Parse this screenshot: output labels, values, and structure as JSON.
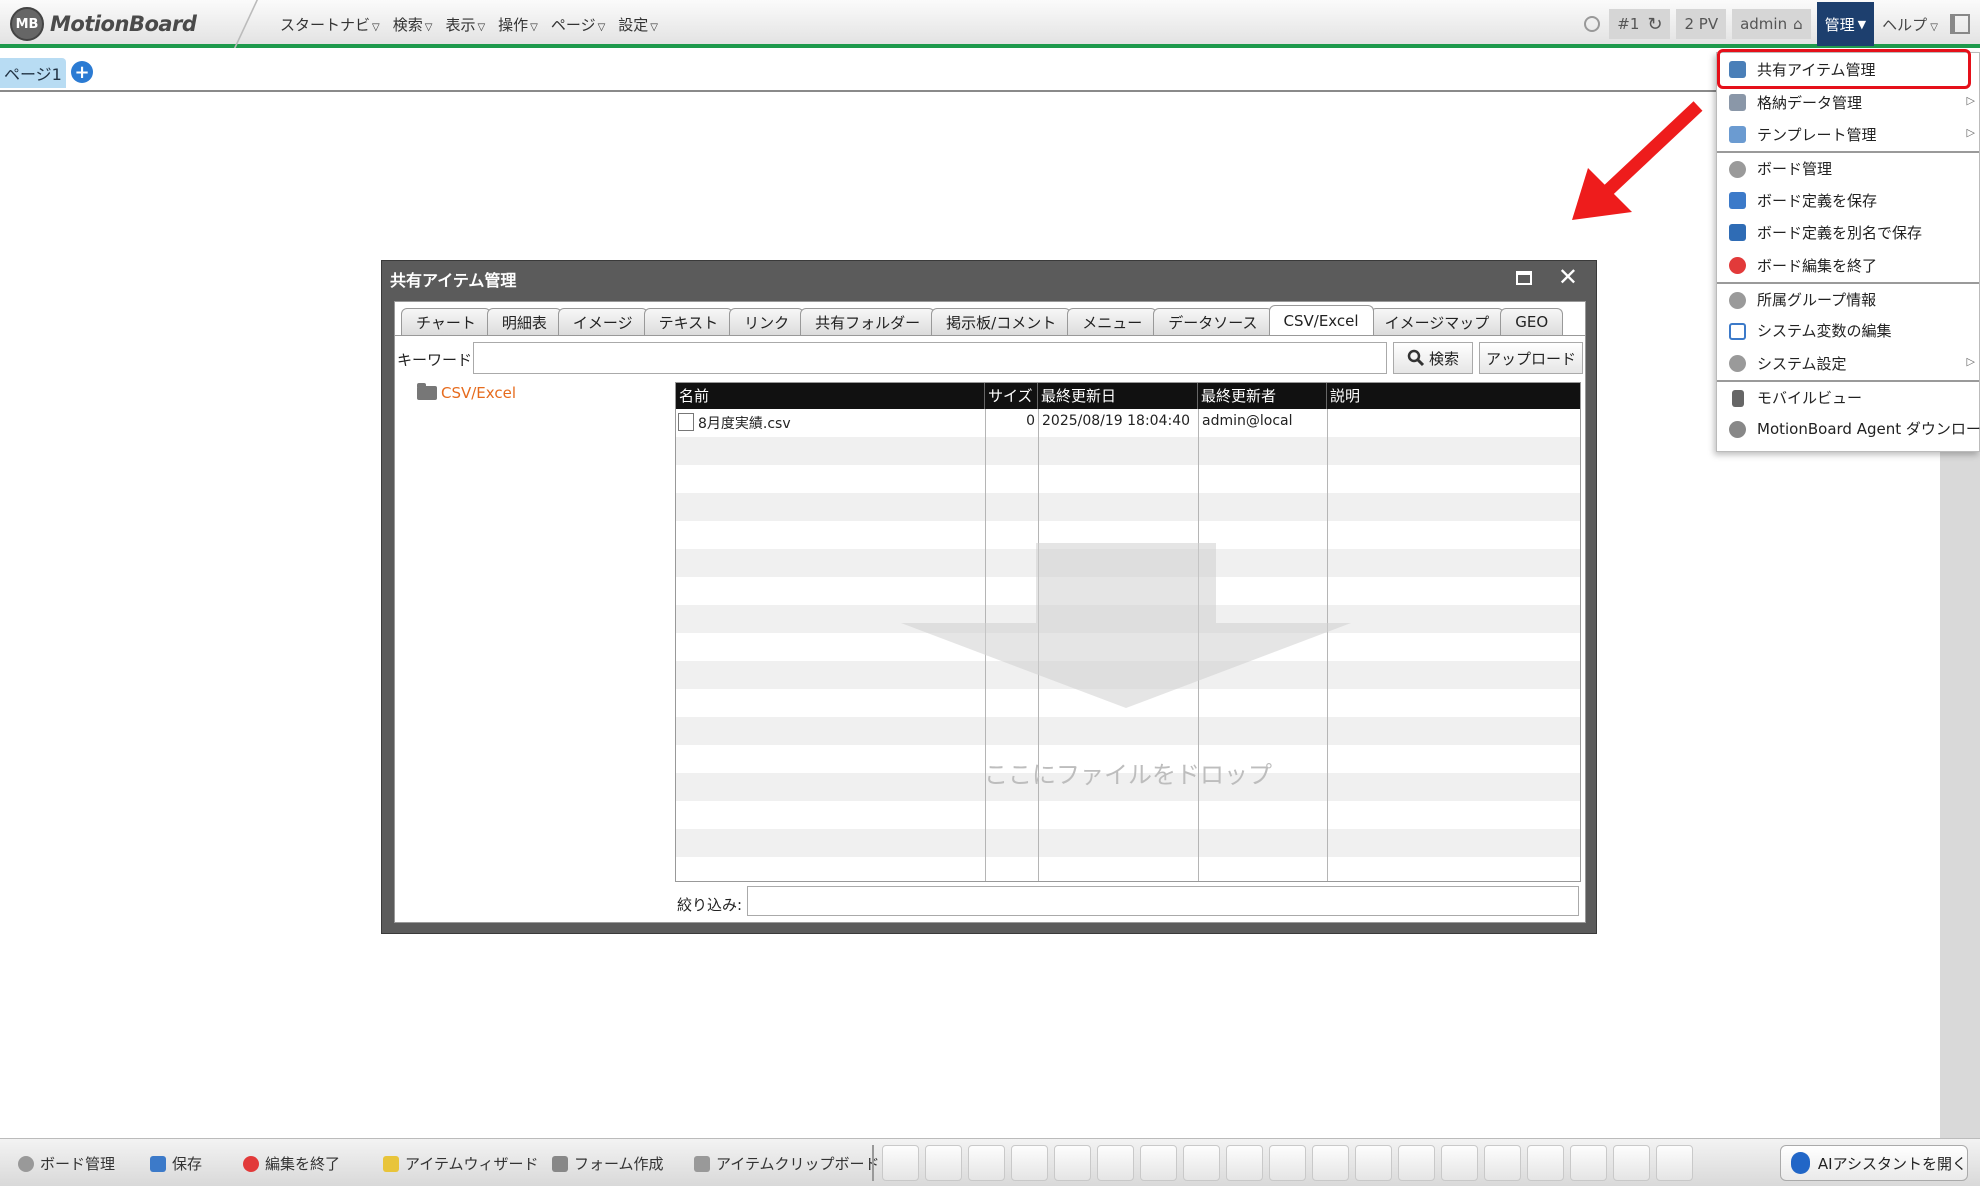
{
  "app": {
    "logo_badge": "MB",
    "logo_text": "MotionBoard"
  },
  "main_menu": [
    "スタートナビ",
    "検索",
    "表示",
    "操作",
    "ページ",
    "設定"
  ],
  "toolbar": {
    "board_num": "#1",
    "pv": "2 PV",
    "user": "admin",
    "kanri": "管理",
    "help": "ヘルプ"
  },
  "page_tabs": {
    "current": "ページ1"
  },
  "admin_menu": {
    "items": [
      {
        "label": "共有アイテム管理",
        "icon": "folder-share-icon",
        "submenu": false
      },
      {
        "label": "格納データ管理",
        "icon": "database-icon",
        "submenu": true
      },
      {
        "label": "テンプレート管理",
        "icon": "template-icon",
        "submenu": true
      },
      {
        "label": "ボード管理",
        "icon": "gear-icon",
        "submenu": false
      },
      {
        "label": "ボード定義を保存",
        "icon": "save-icon",
        "submenu": false
      },
      {
        "label": "ボード定義を別名で保存",
        "icon": "save-as-icon",
        "submenu": false
      },
      {
        "label": "ボード編集を終了",
        "icon": "close-circle-icon",
        "submenu": false
      },
      {
        "label": "所属グループ情報",
        "icon": "group-icon",
        "submenu": false
      },
      {
        "label": "システム変数の編集",
        "icon": "variable-icon",
        "submenu": false
      },
      {
        "label": "システム設定",
        "icon": "gear-icon",
        "submenu": true
      },
      {
        "label": "モバイルビュー",
        "icon": "mobile-icon",
        "submenu": false
      },
      {
        "label": "MotionBoard Agent ダウンロード",
        "icon": "agent-icon",
        "submenu": false
      }
    ]
  },
  "dialog": {
    "title": "共有アイテム管理",
    "tabs": [
      "チャート",
      "明細表",
      "イメージ",
      "テキスト",
      "リンク",
      "共有フォルダー",
      "掲示板/コメント",
      "メニュー",
      "データソース",
      "CSV/Excel",
      "イメージマップ",
      "GEO"
    ],
    "active_tab": "CSV/Excel",
    "keyword_label": "キーワード:",
    "keyword_value": "",
    "search_button": "検索",
    "upload_button": "アップロード",
    "tree_folder": "CSV/Excel",
    "columns": [
      "名前",
      "サイズ",
      "最終更新日",
      "最終更新者",
      "説明"
    ],
    "rows": [
      {
        "name": "8月度実績.csv",
        "size": "0",
        "updated": "2025/08/19 18:04:40",
        "updated_by": "admin@local",
        "description": ""
      }
    ],
    "drop_text": "ここにファイルをドロップ",
    "filter_label": "絞り込み:",
    "filter_value": ""
  },
  "bottom_toolbar": {
    "items": [
      {
        "label": "ボード管理",
        "icon": "gear-icon"
      },
      {
        "label": "保存",
        "icon": "save-icon"
      },
      {
        "label": "編集を終了",
        "icon": "close-circle-icon"
      },
      {
        "label": "アイテムウィザード",
        "icon": "wizard-icon"
      },
      {
        "label": "フォーム作成",
        "icon": "form-icon"
      },
      {
        "label": "アイテムクリップボード",
        "icon": "clipboard-icon"
      }
    ],
    "palette_icons": [
      "layout-icon",
      "chart-icon",
      "table-icon",
      "clock-icon",
      "image-icon",
      "network-icon",
      "picture-icon",
      "text-icon",
      "map-pin-icon",
      "comment-icon",
      "folder-icon",
      "button-icon",
      "shapes-icon",
      "form-icon",
      "dashboard-icon",
      "info-icon",
      "cube-icon",
      "spellcheck-icon",
      "plugin-icon"
    ],
    "ai_button": "AIアシスタントを開く"
  },
  "colors": {
    "accent_green": "#1e9a4c",
    "menu_highlight": "#e5101a",
    "kanri_bg": "#1d3f6e",
    "tree_orange": "#e66b1d"
  }
}
